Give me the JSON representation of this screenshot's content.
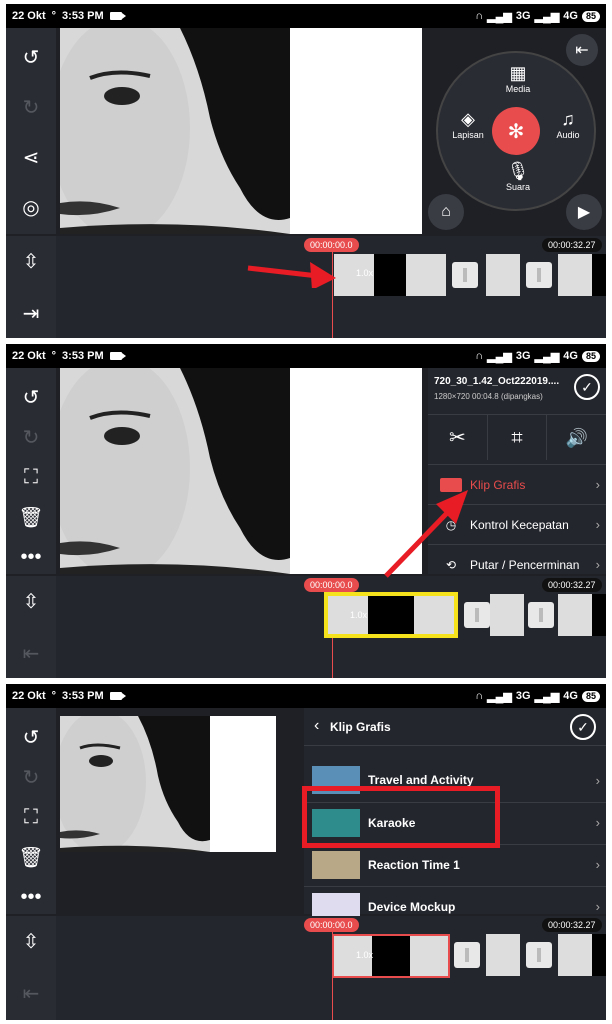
{
  "status": {
    "date": "22 Okt",
    "time": "3:53 PM",
    "network": "3G",
    "network2": "4G",
    "battery": "85"
  },
  "panel1": {
    "media_wheel": {
      "media": "Media",
      "layer": "Lapisan",
      "audio": "Audio",
      "voice": "Suara"
    },
    "time_current": "00:00:00.0",
    "time_total": "00:00:32.27"
  },
  "panel2": {
    "clip_title": "720_30_1.42_Oct222019....",
    "clip_meta": "1280×720  00:04.8 (dipangkas)",
    "menu": [
      "Klip Grafis",
      "Kontrol Kecepatan",
      "Putar / Pencerminan"
    ],
    "time_current": "00:00:00.0",
    "time_total": "00:00:32.27"
  },
  "panel3": {
    "header": "Klip Grafis",
    "items": [
      "Travel and Activity",
      "Karaoke",
      "Reaction Time 1",
      "Device Mockup"
    ],
    "time_current": "00:00:00.0",
    "time_total": "00:00:32.27"
  },
  "colors": {
    "accent": "#e84c4c",
    "highlight": "#e81c24",
    "selected_clip": "#f5e11c"
  }
}
